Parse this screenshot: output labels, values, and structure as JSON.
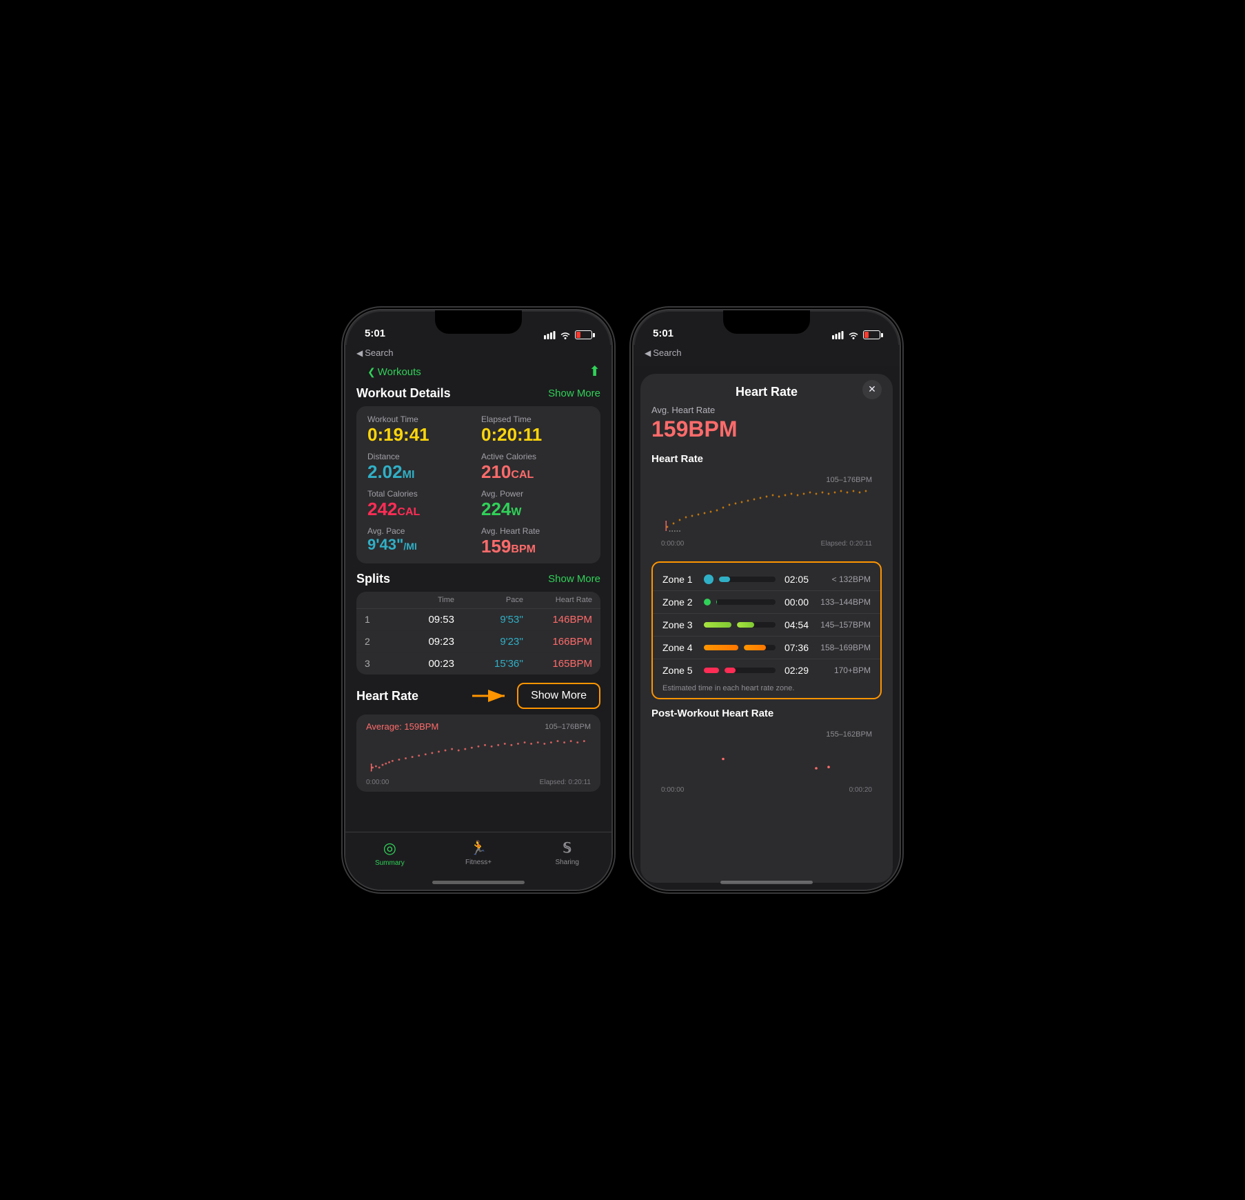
{
  "phone1": {
    "status": {
      "time": "5:01",
      "signal": "signal-icon",
      "wifi": "wifi-icon",
      "battery": "battery-icon"
    },
    "back_search": "◀ Search",
    "nav_back": "Workouts",
    "page_title": "Workout Details",
    "show_more_header": "Show More",
    "stats": [
      {
        "label": "Workout Time",
        "value": "0:19:41",
        "color": "yellow"
      },
      {
        "label": "Elapsed Time",
        "value": "0:20:11",
        "color": "yellow"
      },
      {
        "label": "Distance",
        "value": "2.02",
        "unit": "MI",
        "color": "blue"
      },
      {
        "label": "Active Calories",
        "value": "210",
        "unit": "CAL",
        "color": "red"
      },
      {
        "label": "Total Calories",
        "value": "242",
        "unit": "CAL",
        "color": "pink"
      },
      {
        "label": "Avg. Power",
        "value": "224",
        "unit": "W",
        "color": "green"
      },
      {
        "label": "Avg. Pace",
        "value": "9'43\"",
        "unit": "/MI",
        "color": "blue"
      },
      {
        "label": "Avg. Heart Rate",
        "value": "159",
        "unit": "BPM",
        "color": "red"
      }
    ],
    "splits": {
      "title": "Splits",
      "show_more": "Show More",
      "headers": [
        "",
        "Time",
        "Pace",
        "Heart Rate"
      ],
      "rows": [
        {
          "num": "1",
          "time": "09:53",
          "pace": "9'53''",
          "hr": "146BPM"
        },
        {
          "num": "2",
          "time": "09:23",
          "pace": "9'23''",
          "hr": "166BPM"
        },
        {
          "num": "3",
          "time": "00:23",
          "pace": "15'36''",
          "hr": "165BPM"
        }
      ]
    },
    "heart_rate": {
      "title": "Heart Rate",
      "show_more_btn": "Show More",
      "avg_label": "Average: 159BPM",
      "range": "105–176BPM",
      "time_start": "0:00:00",
      "time_end": "Elapsed: 0:20:11"
    },
    "tabs": [
      {
        "label": "Summary",
        "icon": "◎",
        "active": true
      },
      {
        "label": "Fitness+",
        "icon": "🏃",
        "active": false
      },
      {
        "label": "Sharing",
        "icon": "S",
        "active": false
      }
    ]
  },
  "phone2": {
    "status": {
      "time": "5:01"
    },
    "back_search": "◀ Search",
    "modal": {
      "title": "Heart Rate",
      "close_btn": "✕",
      "avg_hr_label": "Avg. Heart Rate",
      "avg_hr_value": "159BPM",
      "hr_section_title": "Heart Rate",
      "hr_range": "105–176BPM",
      "time_start": "0:00:00",
      "time_elapsed": "Elapsed: 0:20:11",
      "zones": [
        {
          "name": "Zone 1",
          "color": "#30b0c7",
          "time": "02:05",
          "bpm": "< 132BPM",
          "bar_pct": 20
        },
        {
          "name": "Zone 2",
          "color": "#30d158",
          "time": "00:00",
          "bpm": "133–144BPM",
          "bar_pct": 0
        },
        {
          "name": "Zone 3",
          "color": "#a8e440",
          "time": "04:54",
          "bpm": "145–157BPM",
          "bar_pct": 45
        },
        {
          "name": "Zone 4",
          "color": "#ff9500",
          "time": "07:36",
          "bpm": "158–169BPM",
          "bar_pct": 70
        },
        {
          "name": "Zone 5",
          "color": "#ff2d55",
          "time": "02:29",
          "bpm": "170+BPM",
          "bar_pct": 22
        }
      ],
      "zone_note": "Estimated time in each heart rate zone.",
      "post_workout_title": "Post-Workout Heart Rate",
      "post_workout_range": "155–162BPM",
      "post_time_start": "0:00:00",
      "post_time_end": "0:00:20"
    }
  },
  "arrow": {
    "color": "#ff9500"
  }
}
